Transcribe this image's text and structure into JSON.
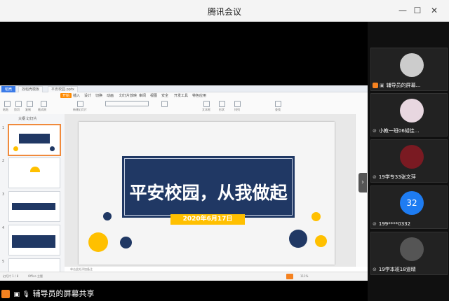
{
  "window": {
    "title": "腾讯会议"
  },
  "share": {
    "presenter_label": "辅导员的屏幕共享",
    "wps": {
      "tabs": [
        "稻壳",
        "找稻壳模板",
        "平安校园.pptx"
      ],
      "menu": [
        "开始",
        "插入",
        "设计",
        "切换",
        "动画",
        "幻灯片放映",
        "审阅",
        "视图",
        "安全",
        "开发工具",
        "特色应用"
      ],
      "active_menu": "开始",
      "toolbar_labels": [
        "粘贴",
        "剪切",
        "复制",
        "格式刷",
        "当前开始",
        "新建幻灯片",
        "版式",
        "重置",
        "节",
        "段落",
        "文本框",
        "形状",
        "排列",
        "轮廓",
        "替换",
        "选择",
        "查找"
      ],
      "thumbs_header": "大纲  幻灯片",
      "notes_placeholder": "单击此处添加备注",
      "status": {
        "slide_counter": "幻灯片 1 / 8",
        "theme": "Office 主题",
        "zoom": "111%"
      }
    },
    "slide": {
      "title": "平安校园，从我做起",
      "date": "2020年6月17日"
    }
  },
  "participants": [
    {
      "name": "辅导员的屏幕...",
      "role": "host"
    },
    {
      "name": "小教一班06胡佳..."
    },
    {
      "name": "19学专33张文萍"
    },
    {
      "name": "199****0332",
      "initials": "32"
    },
    {
      "name": "19学本班18道晴"
    }
  ],
  "colors": {
    "slide_navy": "#203864",
    "slide_yellow": "#ffc000",
    "wps_accent": "#ff8a00",
    "avatar_blue": "#1e7cf2"
  }
}
